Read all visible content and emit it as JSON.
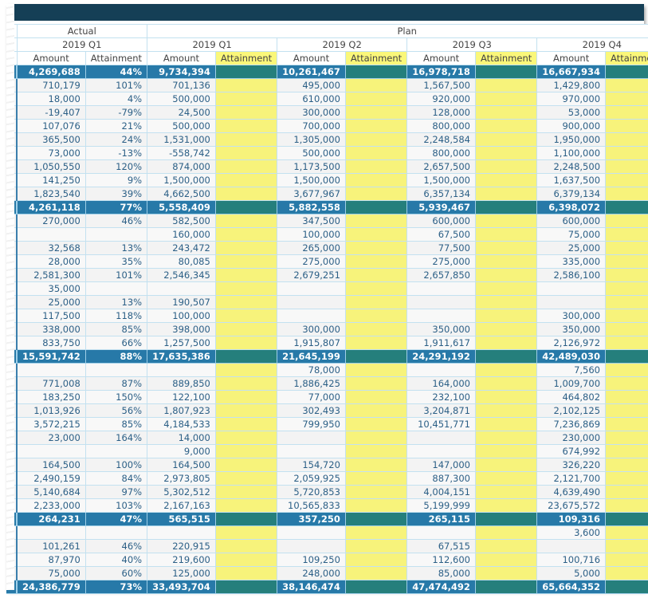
{
  "colors": {
    "header_bar": "#153f56",
    "subtotal": "#2779a8",
    "subtotal_highlight": "#257f7c",
    "highlight": "#faf77a",
    "text": "#2b5f86"
  },
  "header": {
    "groups": {
      "actual": "Actual",
      "plan": "Plan"
    },
    "periods": {
      "actual_q1": "2019 Q1",
      "plan_q1": "2019 Q1",
      "plan_q2": "2019 Q2",
      "plan_q3": "2019 Q3",
      "plan_q4": "2019 Q4"
    },
    "measures": {
      "amount": "Amount",
      "attainment": "Attainment"
    }
  },
  "rows": [
    {
      "type": "subtotal",
      "a_amt": "4,269,688",
      "a_att": "44%",
      "p1": "9,734,394",
      "p2": "10,261,467",
      "p3": "16,978,718",
      "p4": "16,667,934"
    },
    {
      "type": "detail",
      "a_amt": "710,179",
      "a_att": "101%",
      "p1": "701,136",
      "p2": "495,000",
      "p3": "1,567,500",
      "p4": "1,429,800"
    },
    {
      "type": "detail",
      "a_amt": "18,000",
      "a_att": "4%",
      "p1": "500,000",
      "p2": "610,000",
      "p3": "920,000",
      "p4": "970,000"
    },
    {
      "type": "detail",
      "a_amt": "-19,407",
      "a_att": "-79%",
      "p1": "24,500",
      "p2": "300,000",
      "p3": "128,000",
      "p4": "53,000"
    },
    {
      "type": "detail",
      "a_amt": "107,076",
      "a_att": "21%",
      "p1": "500,000",
      "p2": "700,000",
      "p3": "800,000",
      "p4": "900,000"
    },
    {
      "type": "detail",
      "a_amt": "365,500",
      "a_att": "24%",
      "p1": "1,531,000",
      "p2": "1,305,000",
      "p3": "2,248,584",
      "p4": "1,950,000"
    },
    {
      "type": "detail",
      "a_amt": "73,000",
      "a_att": "-13%",
      "p1": "-558,742",
      "p2": "500,000",
      "p3": "800,000",
      "p4": "1,100,000"
    },
    {
      "type": "detail",
      "a_amt": "1,050,550",
      "a_att": "120%",
      "p1": "874,000",
      "p2": "1,173,500",
      "p3": "2,657,500",
      "p4": "2,248,500"
    },
    {
      "type": "detail",
      "a_amt": "141,250",
      "a_att": "9%",
      "p1": "1,500,000",
      "p2": "1,500,000",
      "p3": "1,500,000",
      "p4": "1,637,500"
    },
    {
      "type": "detail",
      "a_amt": "1,823,540",
      "a_att": "39%",
      "p1": "4,662,500",
      "p2": "3,677,967",
      "p3": "6,357,134",
      "p4": "6,379,134"
    },
    {
      "type": "subtotal",
      "a_amt": "4,261,118",
      "a_att": "77%",
      "p1": "5,558,409",
      "p2": "5,882,558",
      "p3": "5,939,467",
      "p4": "6,398,072"
    },
    {
      "type": "detail",
      "a_amt": "270,000",
      "a_att": "46%",
      "p1": "582,500",
      "p2": "347,500",
      "p3": "600,000",
      "p4": "600,000"
    },
    {
      "type": "detail",
      "a_amt": "",
      "a_att": "",
      "p1": "160,000",
      "p2": "100,000",
      "p3": "67,500",
      "p4": "75,000"
    },
    {
      "type": "detail",
      "a_amt": "32,568",
      "a_att": "13%",
      "p1": "243,472",
      "p2": "265,000",
      "p3": "77,500",
      "p4": "25,000"
    },
    {
      "type": "detail",
      "a_amt": "28,000",
      "a_att": "35%",
      "p1": "80,085",
      "p2": "275,000",
      "p3": "275,000",
      "p4": "335,000"
    },
    {
      "type": "detail",
      "a_amt": "2,581,300",
      "a_att": "101%",
      "p1": "2,546,345",
      "p2": "2,679,251",
      "p3": "2,657,850",
      "p4": "2,586,100"
    },
    {
      "type": "detail",
      "a_amt": "35,000",
      "a_att": "",
      "p1": "",
      "p2": "",
      "p3": "",
      "p4": ""
    },
    {
      "type": "detail",
      "a_amt": "25,000",
      "a_att": "13%",
      "p1": "190,507",
      "p2": "",
      "p3": "",
      "p4": ""
    },
    {
      "type": "detail",
      "a_amt": "117,500",
      "a_att": "118%",
      "p1": "100,000",
      "p2": "",
      "p3": "",
      "p4": "300,000"
    },
    {
      "type": "detail",
      "a_amt": "338,000",
      "a_att": "85%",
      "p1": "398,000",
      "p2": "300,000",
      "p3": "350,000",
      "p4": "350,000"
    },
    {
      "type": "detail",
      "a_amt": "833,750",
      "a_att": "66%",
      "p1": "1,257,500",
      "p2": "1,915,807",
      "p3": "1,911,617",
      "p4": "2,126,972"
    },
    {
      "type": "subtotal",
      "a_amt": "15,591,742",
      "a_att": "88%",
      "p1": "17,635,386",
      "p2": "21,645,199",
      "p3": "24,291,192",
      "p4": "42,489,030"
    },
    {
      "type": "detail",
      "a_amt": "",
      "a_att": "",
      "p1": "",
      "p2": "78,000",
      "p3": "",
      "p4": "7,560"
    },
    {
      "type": "detail",
      "a_amt": "771,008",
      "a_att": "87%",
      "p1": "889,850",
      "p2": "1,886,425",
      "p3": "164,000",
      "p4": "1,009,700"
    },
    {
      "type": "detail",
      "a_amt": "183,250",
      "a_att": "150%",
      "p1": "122,100",
      "p2": "77,000",
      "p3": "232,100",
      "p4": "464,802"
    },
    {
      "type": "detail",
      "a_amt": "1,013,926",
      "a_att": "56%",
      "p1": "1,807,923",
      "p2": "302,493",
      "p3": "3,204,871",
      "p4": "2,102,125"
    },
    {
      "type": "detail",
      "a_amt": "3,572,215",
      "a_att": "85%",
      "p1": "4,184,533",
      "p2": "799,950",
      "p3": "10,451,771",
      "p4": "7,236,869"
    },
    {
      "type": "detail",
      "a_amt": "23,000",
      "a_att": "164%",
      "p1": "14,000",
      "p2": "",
      "p3": "",
      "p4": "230,000"
    },
    {
      "type": "detail",
      "a_amt": "",
      "a_att": "",
      "p1": "9,000",
      "p2": "",
      "p3": "",
      "p4": "674,992"
    },
    {
      "type": "detail",
      "a_amt": "164,500",
      "a_att": "100%",
      "p1": "164,500",
      "p2": "154,720",
      "p3": "147,000",
      "p4": "326,220"
    },
    {
      "type": "detail",
      "a_amt": "2,490,159",
      "a_att": "84%",
      "p1": "2,973,805",
      "p2": "2,059,925",
      "p3": "887,300",
      "p4": "2,121,700"
    },
    {
      "type": "detail",
      "a_amt": "5,140,684",
      "a_att": "97%",
      "p1": "5,302,512",
      "p2": "5,720,853",
      "p3": "4,004,151",
      "p4": "4,639,490"
    },
    {
      "type": "detail",
      "a_amt": "2,233,000",
      "a_att": "103%",
      "p1": "2,167,163",
      "p2": "10,565,833",
      "p3": "5,199,999",
      "p4": "23,675,572"
    },
    {
      "type": "subtotal",
      "a_amt": "264,231",
      "a_att": "47%",
      "p1": "565,515",
      "p2": "357,250",
      "p3": "265,115",
      "p4": "109,316"
    },
    {
      "type": "detail",
      "a_amt": "",
      "a_att": "",
      "p1": "",
      "p2": "",
      "p3": "",
      "p4": "3,600"
    },
    {
      "type": "detail",
      "a_amt": "101,261",
      "a_att": "46%",
      "p1": "220,915",
      "p2": "",
      "p3": "67,515",
      "p4": ""
    },
    {
      "type": "detail",
      "a_amt": "87,970",
      "a_att": "40%",
      "p1": "219,600",
      "p2": "109,250",
      "p3": "112,600",
      "p4": "100,716"
    },
    {
      "type": "detail",
      "a_amt": "75,000",
      "a_att": "60%",
      "p1": "125,000",
      "p2": "248,000",
      "p3": "85,000",
      "p4": "5,000"
    },
    {
      "type": "subtotal",
      "a_amt": "24,386,779",
      "a_att": "73%",
      "p1": "33,493,704",
      "p2": "38,146,474",
      "p3": "47,474,492",
      "p4": "65,664,352"
    }
  ]
}
